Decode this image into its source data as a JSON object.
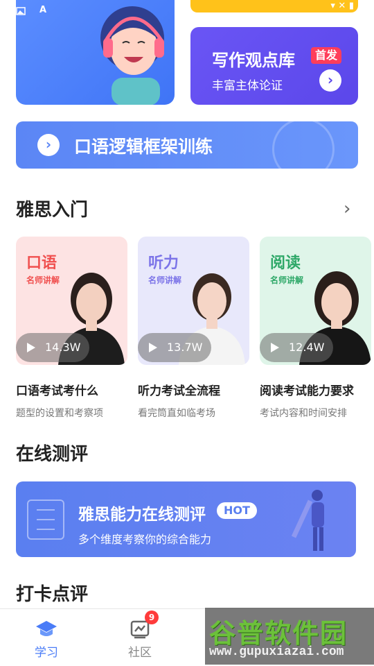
{
  "top_banners": {
    "left_banner_letter": "A",
    "writing_card": {
      "title": "写作观点库",
      "badge": "首发",
      "subtitle": "丰富主体论证"
    },
    "oral_card": {
      "title": "口语逻辑框架训练"
    }
  },
  "section_intro": {
    "title": "雅思入门",
    "courses": [
      {
        "tag": "口语",
        "tag_sub": "名师讲解",
        "plays": "14.3W",
        "title": "口语考试考什么",
        "desc": "题型的设置和考察项",
        "bg": "#fde3e3",
        "tag_color": "#f0504f"
      },
      {
        "tag": "听力",
        "tag_sub": "名师讲解",
        "plays": "13.7W",
        "title": "听力考试全流程",
        "desc": "看完筒直如临考场",
        "bg": "#e8e8fb",
        "tag_color": "#7c74e8"
      },
      {
        "tag": "阅读",
        "tag_sub": "名师讲解",
        "plays": "12.4W",
        "title": "阅读考试能力要求",
        "desc": "考试内容和时间安排",
        "bg": "#dff5e9",
        "tag_color": "#2ea868"
      }
    ]
  },
  "section_assess": {
    "title": "在线测评",
    "card": {
      "title": "雅思能力在线测评",
      "badge": "HOT",
      "subtitle": "多个维度考察你的综合能力"
    }
  },
  "section_checkin": {
    "title": "打卡点评"
  },
  "bottom_nav": {
    "items": [
      {
        "label": "学习",
        "icon": "graduation-cap-icon",
        "active": true
      },
      {
        "label": "社区",
        "icon": "chart-board-icon",
        "active": false,
        "badge": "9"
      }
    ]
  },
  "watermark": {
    "brand": "谷普软件园",
    "url": "www.gupuxiazai.com"
  },
  "colors": {
    "accent_blue": "#4a7cf7",
    "writing_purple": "#5b47ea",
    "badge_red": "#ff3d5a"
  }
}
